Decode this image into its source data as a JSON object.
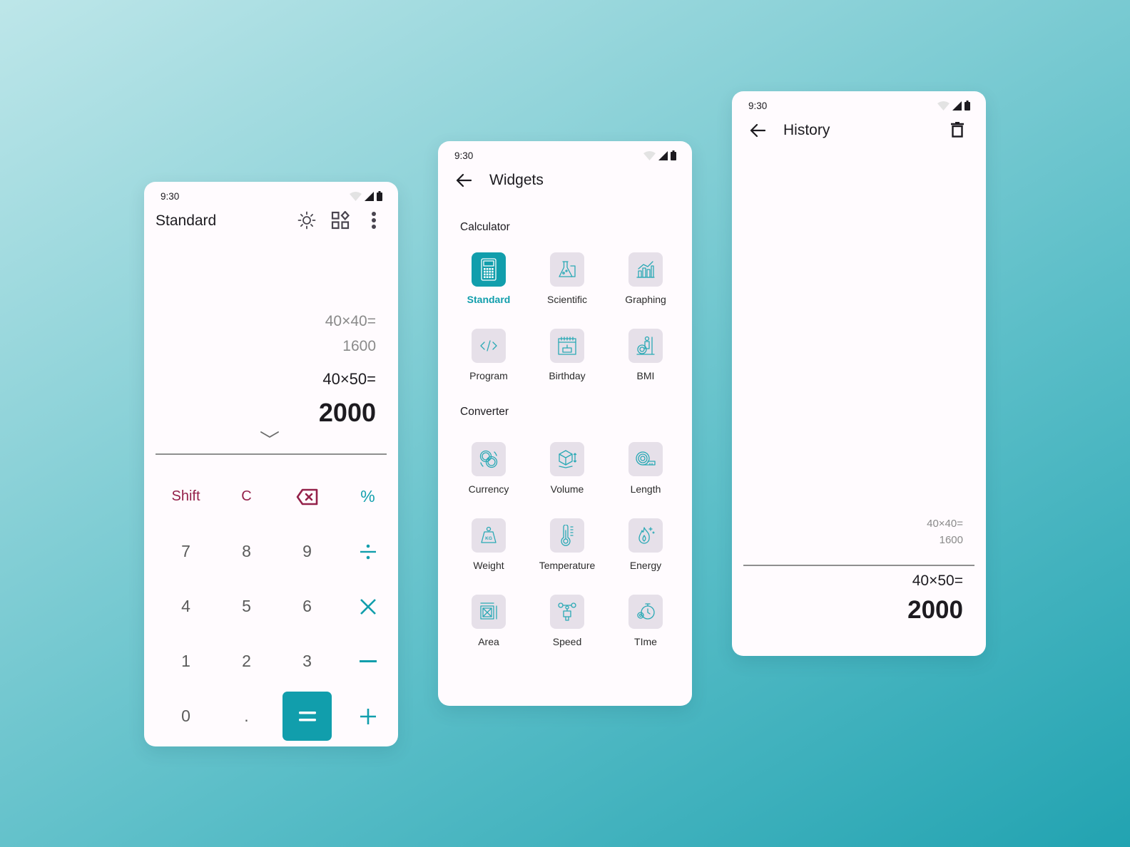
{
  "colors": {
    "accent": "#119eac",
    "function_key": "#94214a",
    "tile_bg": "#e6e0e9",
    "surface": "#fffbfe"
  },
  "status_bar": {
    "time": "9:30",
    "icons": [
      "wifi-icon",
      "signal-icon",
      "battery-icon"
    ]
  },
  "standard": {
    "title": "Standard",
    "actions": [
      "theme-brightness-icon",
      "widgets-grid-icon",
      "more-vert-icon"
    ],
    "display": {
      "previous_expression": "40×40=",
      "previous_result": "1600",
      "current_expression": "40×50=",
      "current_result": "2000"
    },
    "keys": [
      {
        "label": "Shift",
        "type": "fn",
        "name": "shift"
      },
      {
        "label": "C",
        "type": "fn",
        "name": "clear"
      },
      {
        "label": "⌫",
        "type": "fn",
        "name": "backspace",
        "icon": "backspace-icon"
      },
      {
        "label": "%",
        "type": "op",
        "name": "percent"
      },
      {
        "label": "7",
        "type": "num",
        "name": "7"
      },
      {
        "label": "8",
        "type": "num",
        "name": "8"
      },
      {
        "label": "9",
        "type": "num",
        "name": "9"
      },
      {
        "label": "÷",
        "type": "op",
        "name": "divide",
        "icon": "divide-icon"
      },
      {
        "label": "4",
        "type": "num",
        "name": "4"
      },
      {
        "label": "5",
        "type": "num",
        "name": "5"
      },
      {
        "label": "6",
        "type": "num",
        "name": "6"
      },
      {
        "label": "×",
        "type": "op",
        "name": "multiply",
        "icon": "multiply-icon"
      },
      {
        "label": "1",
        "type": "num",
        "name": "1"
      },
      {
        "label": "2",
        "type": "num",
        "name": "2"
      },
      {
        "label": "3",
        "type": "num",
        "name": "3"
      },
      {
        "label": "−",
        "type": "op",
        "name": "minus",
        "icon": "minus-icon"
      },
      {
        "label": "0",
        "type": "num",
        "name": "0"
      },
      {
        "label": ".",
        "type": "num",
        "name": "decimal"
      },
      {
        "label": "=",
        "type": "eq",
        "name": "equals",
        "icon": "equals-icon"
      },
      {
        "label": "+",
        "type": "op",
        "name": "plus",
        "icon": "plus-icon"
      }
    ]
  },
  "widgets": {
    "title": "Widgets",
    "sections": [
      {
        "label": "Calculator",
        "items": [
          {
            "label": "Standard",
            "icon": "calculator-icon",
            "active": true
          },
          {
            "label": "Scientific",
            "icon": "flask-icon",
            "active": false
          },
          {
            "label": "Graphing",
            "icon": "graph-chart-icon",
            "active": false
          },
          {
            "label": "Program",
            "icon": "code-icon",
            "active": false
          },
          {
            "label": "Birthday",
            "icon": "birthday-calendar-icon",
            "active": false
          },
          {
            "label": "BMI",
            "icon": "bmi-scale-icon",
            "active": false
          }
        ]
      },
      {
        "label": "Converter",
        "items": [
          {
            "label": "Currency",
            "icon": "currency-coins-icon",
            "active": false
          },
          {
            "label": "Volume",
            "icon": "cube-volume-icon",
            "active": false
          },
          {
            "label": "Length",
            "icon": "tape-measure-icon",
            "active": false
          },
          {
            "label": "Weight",
            "icon": "kg-weight-icon",
            "active": false
          },
          {
            "label": "Temperature",
            "icon": "thermometer-icon",
            "active": false
          },
          {
            "label": "Energy",
            "icon": "flame-energy-icon",
            "active": false
          },
          {
            "label": "Area",
            "icon": "area-square-icon",
            "active": false
          },
          {
            "label": "Speed",
            "icon": "anemometer-speed-icon",
            "active": false
          },
          {
            "label": "TIme",
            "icon": "stopwatch-icon",
            "active": false
          }
        ]
      }
    ]
  },
  "history": {
    "title": "History",
    "entries": [
      {
        "expression": "40×40=",
        "result": "1600"
      }
    ],
    "current": {
      "expression": "40×50=",
      "result": "2000"
    }
  }
}
